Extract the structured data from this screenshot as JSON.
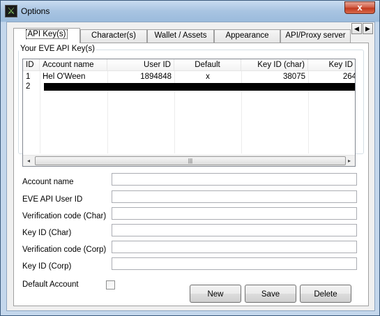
{
  "window": {
    "title": "Options",
    "close_glyph": "x"
  },
  "tabs": {
    "items": [
      {
        "label": "API Key(s)",
        "active": true
      },
      {
        "label": "Character(s)"
      },
      {
        "label": "Wallet / Assets"
      },
      {
        "label": "Appearance"
      },
      {
        "label": "API/Proxy server"
      }
    ],
    "scroll_left": "◀",
    "scroll_right": "▶"
  },
  "group": {
    "legend": "Your EVE API Key(s)"
  },
  "listview": {
    "columns": [
      "ID",
      "Account name",
      "User ID",
      "Default",
      "Key ID (char)",
      "Key ID"
    ],
    "rows": [
      {
        "id": "1",
        "account_name": "Hel O'Ween",
        "user_id": "1894848",
        "default": "x",
        "key_id_char": "38075",
        "key_id": "264"
      },
      {
        "id": "2",
        "account_name": "",
        "user_id": "",
        "default": "",
        "key_id_char": "",
        "key_id": "",
        "selected": true
      }
    ],
    "scroll_left": "◂",
    "scroll_right": "▸",
    "thumb_grip": "|||"
  },
  "form": {
    "account_name_label": "Account name",
    "account_name_value": "",
    "user_id_label": "EVE API User ID",
    "user_id_value": "",
    "vcode_char_label": "Verification code (Char)",
    "vcode_char_value": "",
    "keyid_char_label": "Key ID (Char)",
    "keyid_char_value": "",
    "vcode_corp_label": "Verification code (Corp)",
    "vcode_corp_value": "",
    "keyid_corp_label": "Key ID (Corp)",
    "keyid_corp_value": "",
    "default_account_label": "Default Account",
    "default_account_checked": false
  },
  "buttons": {
    "new_label": "New",
    "save_label": "Save",
    "delete_label": "Delete"
  }
}
